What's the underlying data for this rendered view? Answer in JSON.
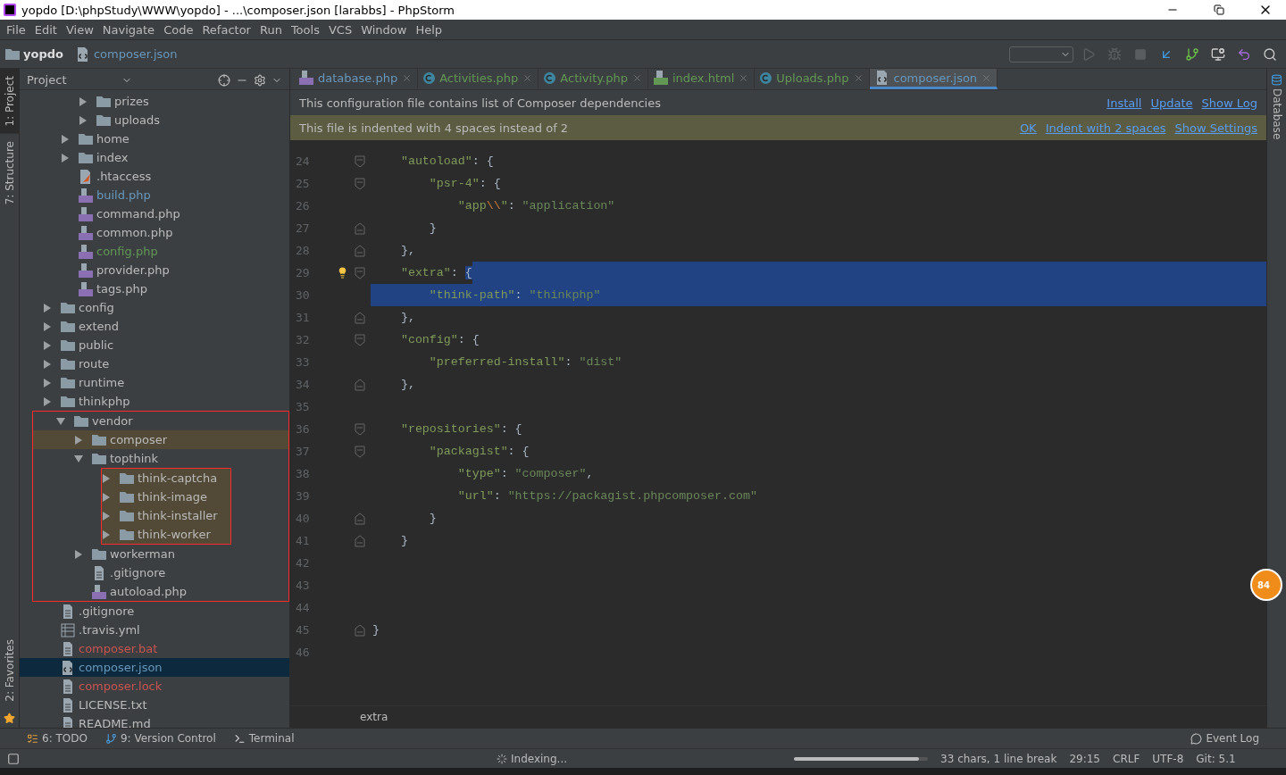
{
  "window": {
    "title": "yopdo [D:\\phpStudy\\WWW\\yopdo] - ...\\composer.json [larabbs] - PhpStorm"
  },
  "menu": [
    "File",
    "Edit",
    "View",
    "Navigate",
    "Code",
    "Refactor",
    "Run",
    "Tools",
    "VCS",
    "Window",
    "Help"
  ],
  "breadcrumbs": [
    {
      "label": "yopdo",
      "kind": "folder"
    },
    {
      "label": "composer.json",
      "kind": "json"
    }
  ],
  "left_stripe": [
    {
      "label": "1: Project",
      "selected": true
    },
    {
      "label": "7: Structure",
      "selected": false
    }
  ],
  "favorites_tab": "2: Favorites",
  "project_panel": {
    "title": "Project",
    "tree": [
      {
        "children": [
          {
            "children": [
              {
                "label": "prizes",
                "kind": "folder",
                "expanded": false
              },
              {
                "label": "uploads",
                "kind": "folder",
                "expanded": false
              }
            ]
          },
          {
            "label": "home",
            "kind": "folder",
            "expanded": false
          },
          {
            "label": "index",
            "kind": "folder",
            "expanded": false
          },
          {
            "label": ".htaccess",
            "kind": "htaccess"
          },
          {
            "label": "build.php",
            "kind": "php",
            "color": "#6897bb"
          },
          {
            "label": "command.php",
            "kind": "php"
          },
          {
            "label": "common.php",
            "kind": "php"
          },
          {
            "label": "config.php",
            "kind": "php",
            "color": "#629755"
          },
          {
            "label": "provider.php",
            "kind": "php"
          },
          {
            "label": "tags.php",
            "kind": "php"
          }
        ]
      },
      {
        "label": "config",
        "kind": "folder",
        "expanded": false
      },
      {
        "label": "extend",
        "kind": "folder",
        "expanded": false
      },
      {
        "label": "public",
        "kind": "folder",
        "expanded": false
      },
      {
        "label": "route",
        "kind": "folder",
        "expanded": false
      },
      {
        "label": "runtime",
        "kind": "folder",
        "expanded": false
      },
      {
        "label": "thinkphp",
        "kind": "folder",
        "expanded": false
      },
      {
        "label": "vendor",
        "kind": "folder",
        "expanded": true,
        "outlined": true,
        "children": [
          {
            "label": "composer",
            "kind": "folder",
            "expanded": false,
            "highlighted": true
          },
          {
            "label": "topthink",
            "kind": "folder",
            "expanded": true,
            "children_outlined": true,
            "children": [
              {
                "label": "think-captcha",
                "kind": "folder",
                "expanded": false,
                "highlighted": true
              },
              {
                "label": "think-image",
                "kind": "folder",
                "expanded": false,
                "highlighted": true
              },
              {
                "label": "think-installer",
                "kind": "folder",
                "expanded": false,
                "highlighted": true
              },
              {
                "label": "think-worker",
                "kind": "folder",
                "expanded": false,
                "highlighted": true
              }
            ]
          },
          {
            "label": "workerman",
            "kind": "folder",
            "expanded": false
          },
          {
            "label": ".gitignore",
            "kind": "file"
          },
          {
            "label": "autoload.php",
            "kind": "php"
          }
        ]
      },
      {
        "label": ".gitignore",
        "kind": "file"
      },
      {
        "label": ".travis.yml",
        "kind": "yml"
      },
      {
        "label": "composer.bat",
        "kind": "file",
        "color": "#c75450"
      },
      {
        "label": "composer.json",
        "kind": "json",
        "color": "#6897bb",
        "selected": true
      },
      {
        "label": "composer.lock",
        "kind": "file",
        "color": "#c75450"
      },
      {
        "label": "LICENSE.txt",
        "kind": "file"
      },
      {
        "label": "README.md",
        "kind": "file"
      }
    ]
  },
  "tabs": [
    {
      "label": "database.php",
      "kind": "php",
      "selected": false,
      "color": "#6897bb"
    },
    {
      "label": "Activities.php",
      "kind": "class",
      "selected": false,
      "color": "#629755"
    },
    {
      "label": "Activity.php",
      "kind": "class",
      "selected": false,
      "color": "#629755"
    },
    {
      "label": "index.html",
      "kind": "html",
      "selected": false,
      "color": "#629755"
    },
    {
      "label": "Uploads.php",
      "kind": "class",
      "selected": false,
      "color": "#629755"
    },
    {
      "label": "composer.json",
      "kind": "json",
      "selected": true,
      "color": "#6897bb"
    }
  ],
  "composer_banner": {
    "text": "This configuration file contains list of Composer dependencies",
    "links": [
      "Install",
      "Update",
      "Show Log"
    ]
  },
  "indent_banner": {
    "text": "This file is indented with 4 spaces instead of 2",
    "links": [
      "OK",
      "Indent with 2 spaces",
      "Show Settings"
    ]
  },
  "code_lines": [
    {
      "number": "24",
      "kind": "fold_start",
      "tokens": [
        {
          "kind": "key",
          "text": "    \"autoload\""
        },
        {
          "kind": "punct",
          "text": ": {"
        }
      ]
    },
    {
      "number": "25",
      "kind": "fold_start",
      "tokens": [
        {
          "kind": "key",
          "text": "        \"psr-4\""
        },
        {
          "kind": "punct",
          "text": ": {"
        }
      ]
    },
    {
      "number": "26",
      "tokens": [
        {
          "kind": "key",
          "text": "            \"app"
        },
        {
          "kind": "escape",
          "text": "\\\\"
        },
        {
          "kind": "key",
          "text": "\""
        },
        {
          "kind": "punct",
          "text": ": "
        },
        {
          "kind": "string",
          "text": "\"application\""
        }
      ]
    },
    {
      "number": "27",
      "kind": "fold_end",
      "tokens": [
        {
          "kind": "punct",
          "text": "        }"
        }
      ]
    },
    {
      "number": "28",
      "kind": "fold_end",
      "tokens": [
        {
          "kind": "punct",
          "text": "    },"
        }
      ]
    },
    {
      "number": "29",
      "kind": "fold_start",
      "bulb": true,
      "tokens": [
        {
          "kind": "key",
          "text": "    \"extra\""
        },
        {
          "kind": "punct",
          "text": ": "
        },
        {
          "kind": "punct",
          "text": "{",
          "selected": true
        }
      ],
      "selected_tail": true
    },
    {
      "number": "30",
      "selected": true,
      "tokens": [
        {
          "kind": "key",
          "text": "        \"think-path\""
        },
        {
          "kind": "punct",
          "text": ": "
        },
        {
          "kind": "string",
          "text": "\"thinkphp\""
        }
      ]
    },
    {
      "number": "31",
      "kind": "fold_end",
      "tokens": [
        {
          "kind": "punct",
          "text": "    },"
        }
      ]
    },
    {
      "number": "32",
      "kind": "fold_start",
      "tokens": [
        {
          "kind": "key",
          "text": "    \"config\""
        },
        {
          "kind": "punct",
          "text": ": {"
        }
      ]
    },
    {
      "number": "33",
      "tokens": [
        {
          "kind": "key",
          "text": "        \"preferred-install\""
        },
        {
          "kind": "punct",
          "text": ": "
        },
        {
          "kind": "string",
          "text": "\"dist\""
        }
      ]
    },
    {
      "number": "34",
      "kind": "fold_end",
      "tokens": [
        {
          "kind": "punct",
          "text": "    },"
        }
      ]
    },
    {
      "number": "35"
    },
    {
      "number": "36",
      "kind": "fold_start",
      "tokens": [
        {
          "kind": "key",
          "text": "    \"repositories\""
        },
        {
          "kind": "punct",
          "text": ": {"
        }
      ]
    },
    {
      "number": "37",
      "kind": "fold_start",
      "tokens": [
        {
          "kind": "key",
          "text": "        \"packagist\""
        },
        {
          "kind": "punct",
          "text": ": {"
        }
      ]
    },
    {
      "number": "38",
      "tokens": [
        {
          "kind": "key",
          "text": "            \"type\""
        },
        {
          "kind": "punct",
          "text": ": "
        },
        {
          "kind": "string",
          "text": "\"composer\""
        },
        {
          "kind": "punct",
          "text": ","
        }
      ]
    },
    {
      "number": "39",
      "tokens": [
        {
          "kind": "key",
          "text": "            \"url\""
        },
        {
          "kind": "punct",
          "text": ": "
        },
        {
          "kind": "string",
          "text": "\"https://packagist.phpcomposer.com\""
        }
      ]
    },
    {
      "number": "40",
      "kind": "fold_end",
      "tokens": [
        {
          "kind": "punct",
          "text": "        }"
        }
      ]
    },
    {
      "number": "41",
      "kind": "fold_end",
      "tokens": [
        {
          "kind": "punct",
          "text": "    }"
        }
      ]
    },
    {
      "number": "42"
    },
    {
      "number": "43"
    },
    {
      "number": "44"
    },
    {
      "number": "45",
      "kind": "fold_end",
      "tokens": [
        {
          "kind": "punct",
          "text": "}"
        }
      ]
    },
    {
      "number": "46"
    }
  ],
  "editor_breadcrumb": "extra",
  "right_stripe": {
    "label": "Database"
  },
  "floating_badge": "84",
  "bottom_tools": [
    {
      "label": "6: TODO",
      "kind": "todo"
    },
    {
      "label": "9: Version Control",
      "kind": "vcs"
    },
    {
      "label": "Terminal",
      "kind": "terminal"
    }
  ],
  "event_log": "Event Log",
  "status": {
    "task": "Indexing...",
    "progress": {
      "level": 0.93
    },
    "items": [
      "33 chars, 1 line break",
      "29:15",
      "CRLF",
      "UTF-8",
      "Git: 5.1"
    ]
  }
}
